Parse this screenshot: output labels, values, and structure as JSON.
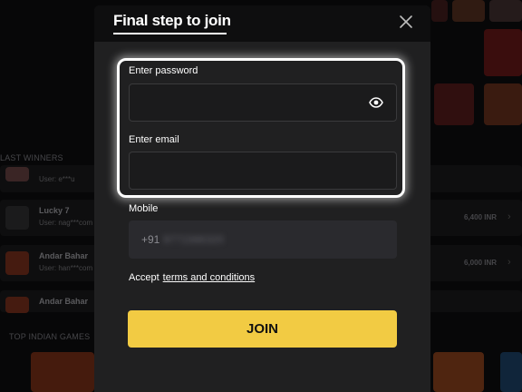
{
  "modal": {
    "title": "Final step to join",
    "password_label": "Enter password",
    "password_value": "",
    "email_label": "Enter email",
    "email_value": "",
    "mobile_label": "Mobile",
    "mobile_prefix": "+91",
    "mobile_number_masked": "9771566320",
    "accept_text": "Accept",
    "terms_link": "terms and conditions",
    "join_label": "JOIN"
  },
  "background": {
    "last_winners_title": "LAST WINNERS",
    "top_games_title": "TOP INDIAN GAMES",
    "winners": [
      {
        "name": "",
        "user": "User: e***u",
        "amount": ""
      },
      {
        "name": "Lucky 7",
        "user": "User: nag***com",
        "amount": "6,400 INR"
      },
      {
        "name": "Andar Bahar",
        "user": "User: han***com",
        "amount": "6,000 INR"
      },
      {
        "name": "Andar Bahar",
        "user": "",
        "amount": ""
      }
    ]
  },
  "colors": {
    "accent": "#f2cb43",
    "modal_bg": "#202021",
    "page_bg": "#0c0c0d"
  }
}
